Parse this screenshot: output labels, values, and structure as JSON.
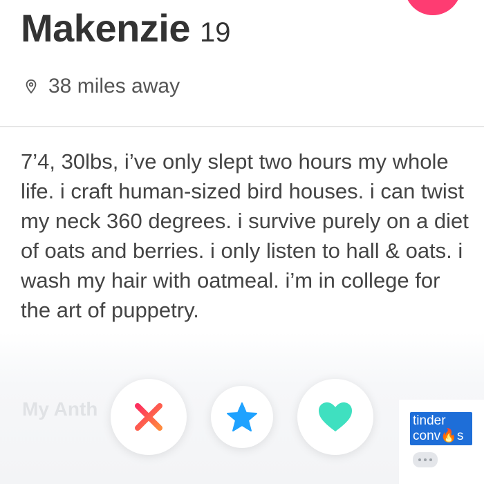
{
  "profile": {
    "name": "Makenzie",
    "age": "19",
    "distance": "38 miles away",
    "bio": "7’4, 30lbs, i’ve only slept two hours my whole life. i craft human-sized bird houses. i can twist my neck 360 degrees. i survive purely on a diet of oats and berries. i only listen to hall & oats. i wash my hair with oatmeal. i’m in college for the art of puppetry.",
    "anthem_heading": "My Anth"
  },
  "actions": {
    "nope_icon": "close-icon",
    "superlike_icon": "star-icon",
    "like_icon": "heart-icon"
  },
  "watermark": {
    "line1": "tinder",
    "line2": "conv",
    "line2_emoji": "🔥",
    "line2_end": "s"
  },
  "colors": {
    "brand": "#fe3c72",
    "nope_start": "#fd2f5f",
    "nope_end": "#ff8a3d",
    "superlike": "#1fa2ff",
    "like": "#3fe0c0",
    "watermark_bg": "#1e6ed8"
  }
}
